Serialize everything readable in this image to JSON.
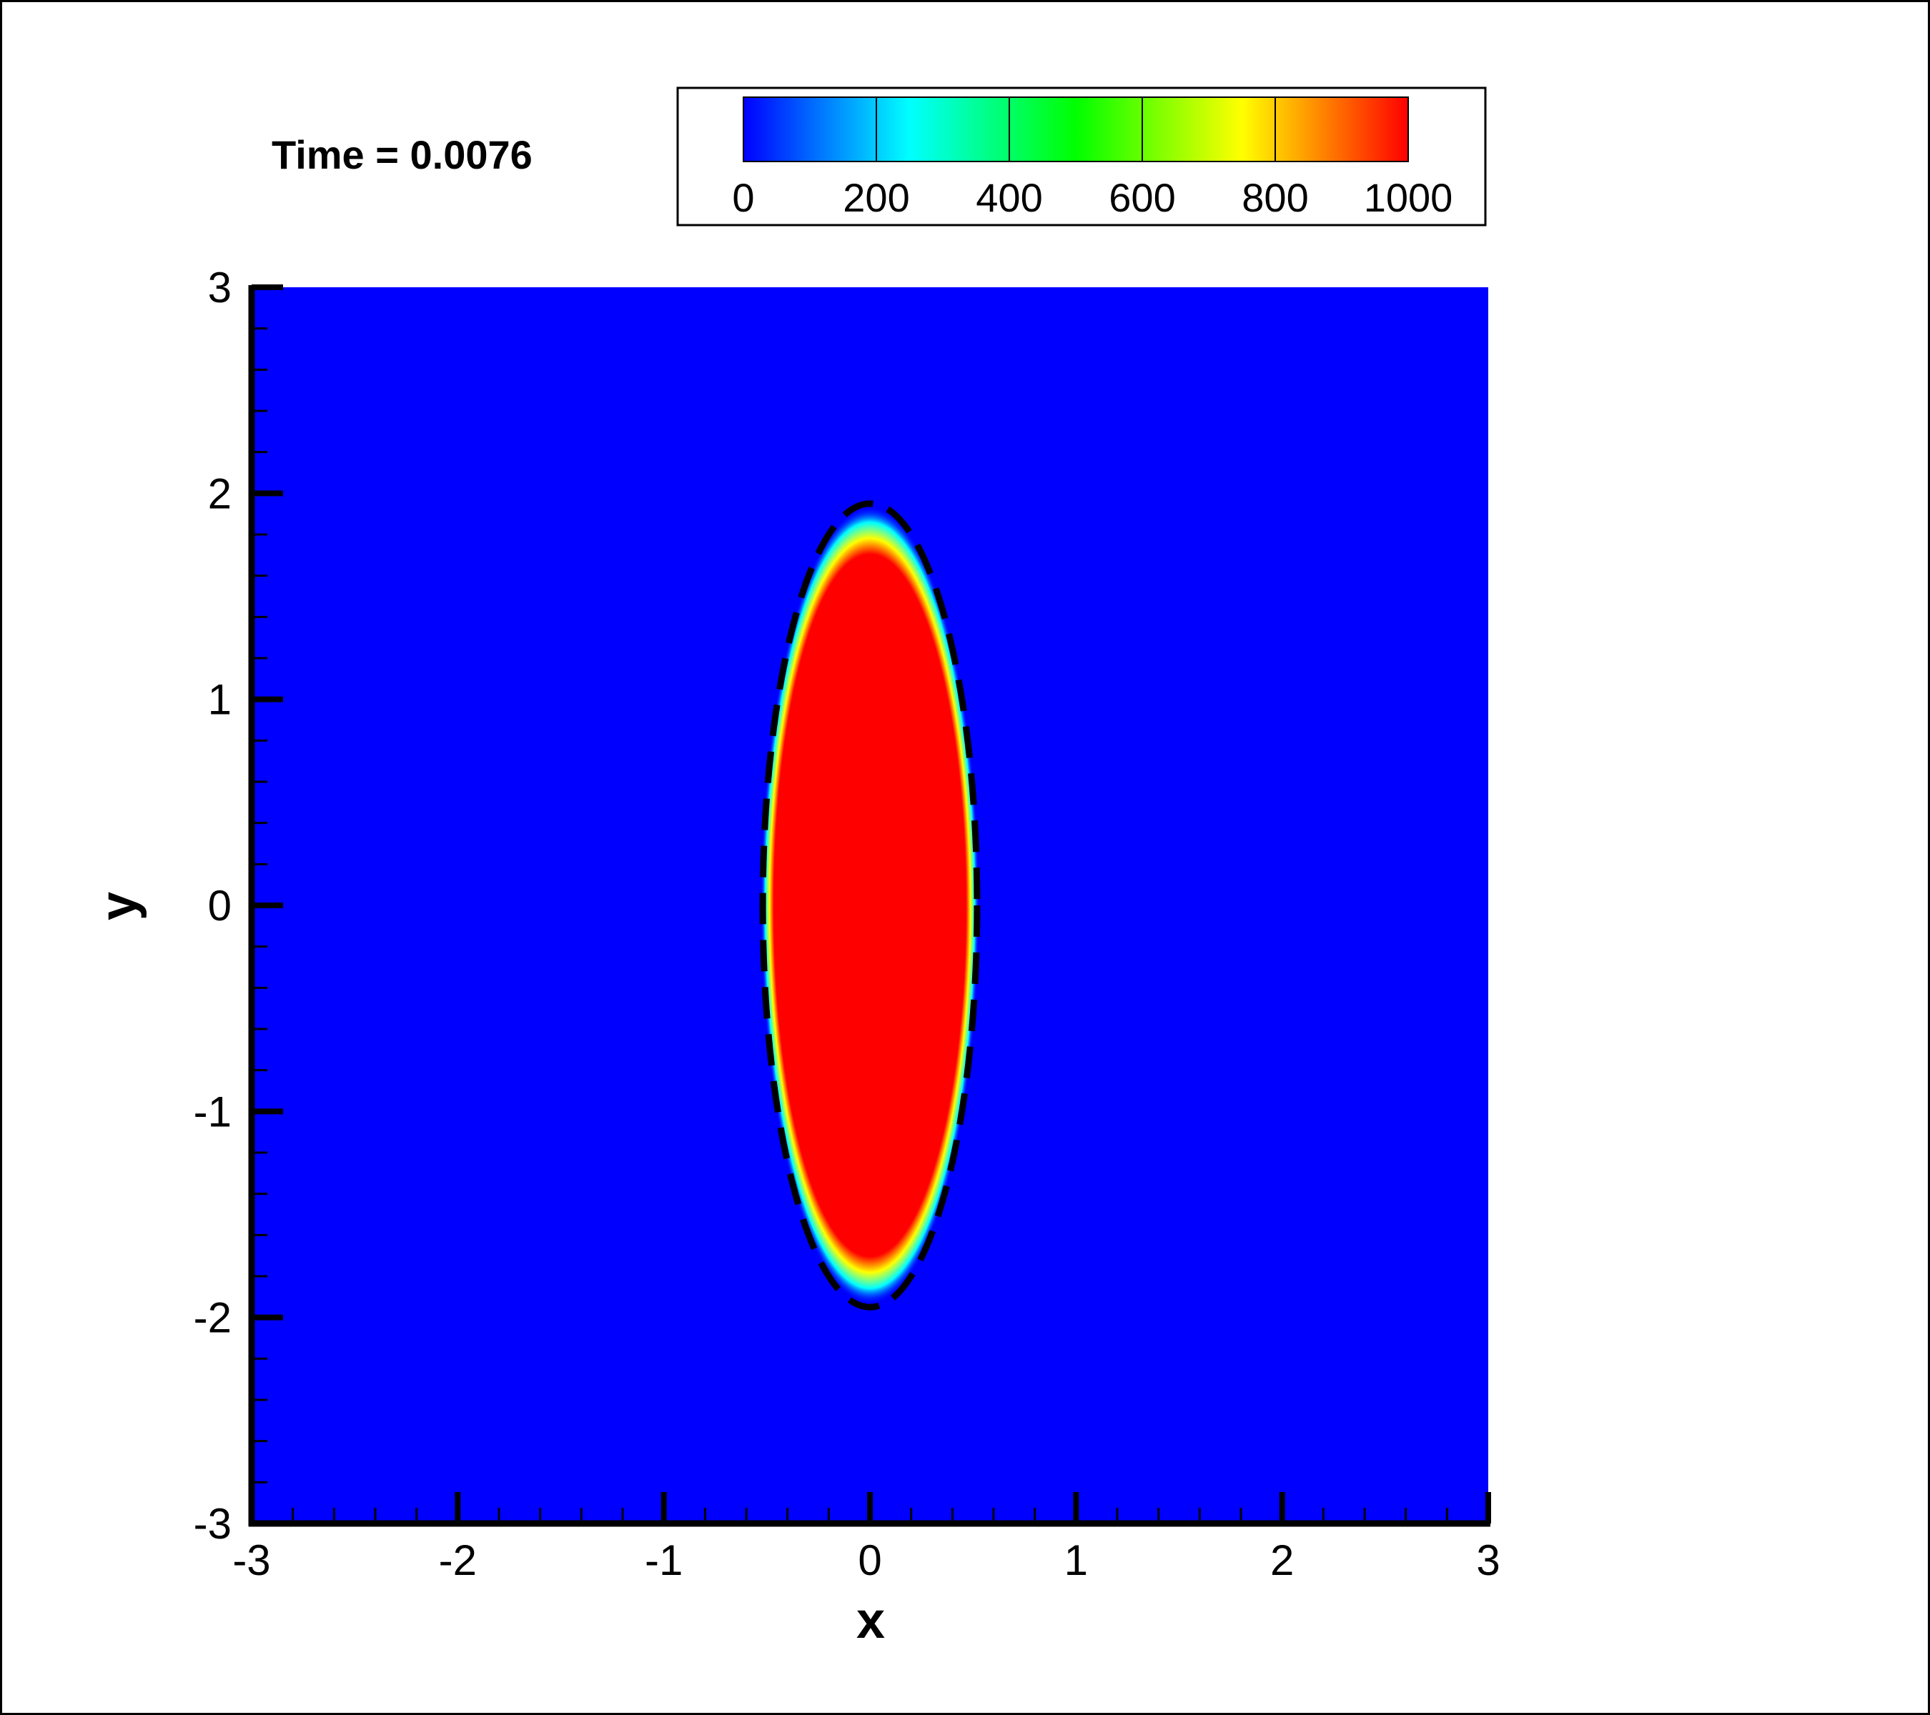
{
  "chart_data": {
    "type": "heatmap",
    "time_label": "Time = 0.0076",
    "xlabel": "x",
    "ylabel": "y",
    "xlim": [
      -3,
      3
    ],
    "ylim": [
      -3,
      3
    ],
    "xticks": [
      -3,
      -2,
      -1,
      0,
      1,
      2,
      3
    ],
    "yticks": [
      -3,
      -2,
      -1,
      0,
      1,
      2,
      3
    ],
    "xtick_labels": [
      "-3",
      "-2",
      "-1",
      "0",
      "1",
      "2",
      "3"
    ],
    "ytick_labels": [
      "-3",
      "-2",
      "-1",
      "0",
      "1",
      "2",
      "3"
    ],
    "colorbar": {
      "range": [
        0,
        1000
      ],
      "ticks": [
        0,
        200,
        400,
        600,
        800,
        1000
      ],
      "tick_labels": [
        "0",
        "200",
        "400",
        "600",
        "800",
        "1000"
      ],
      "colormap": [
        "#0000ff",
        "#00ffff",
        "#00ff00",
        "#ffff00",
        "#ff0000"
      ]
    },
    "field": {
      "background_value": 0,
      "background_color": "#0000ff",
      "region": {
        "shape": "ellipse",
        "center": [
          0,
          0
        ],
        "semi_axis_x": 0.5,
        "semi_axis_y": 1.88,
        "value": 1000,
        "color": "#ff0000"
      }
    },
    "reference_contour": {
      "style": "dashed",
      "color": "#000000",
      "shape": "ellipse",
      "center": [
        0,
        0
      ],
      "semi_axis_x": 0.52,
      "semi_axis_y": 1.95
    }
  }
}
